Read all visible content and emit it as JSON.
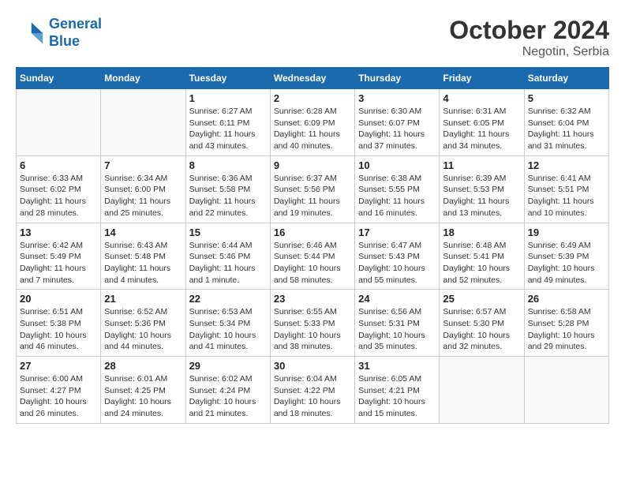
{
  "header": {
    "logo_line1": "General",
    "logo_line2": "Blue",
    "month": "October 2024",
    "location": "Negotin, Serbia"
  },
  "weekdays": [
    "Sunday",
    "Monday",
    "Tuesday",
    "Wednesday",
    "Thursday",
    "Friday",
    "Saturday"
  ],
  "weeks": [
    [
      {
        "day": "",
        "info": ""
      },
      {
        "day": "",
        "info": ""
      },
      {
        "day": "1",
        "info": "Sunrise: 6:27 AM\nSunset: 6:11 PM\nDaylight: 11 hours and 43 minutes."
      },
      {
        "day": "2",
        "info": "Sunrise: 6:28 AM\nSunset: 6:09 PM\nDaylight: 11 hours and 40 minutes."
      },
      {
        "day": "3",
        "info": "Sunrise: 6:30 AM\nSunset: 6:07 PM\nDaylight: 11 hours and 37 minutes."
      },
      {
        "day": "4",
        "info": "Sunrise: 6:31 AM\nSunset: 6:05 PM\nDaylight: 11 hours and 34 minutes."
      },
      {
        "day": "5",
        "info": "Sunrise: 6:32 AM\nSunset: 6:04 PM\nDaylight: 11 hours and 31 minutes."
      }
    ],
    [
      {
        "day": "6",
        "info": "Sunrise: 6:33 AM\nSunset: 6:02 PM\nDaylight: 11 hours and 28 minutes."
      },
      {
        "day": "7",
        "info": "Sunrise: 6:34 AM\nSunset: 6:00 PM\nDaylight: 11 hours and 25 minutes."
      },
      {
        "day": "8",
        "info": "Sunrise: 6:36 AM\nSunset: 5:58 PM\nDaylight: 11 hours and 22 minutes."
      },
      {
        "day": "9",
        "info": "Sunrise: 6:37 AM\nSunset: 5:56 PM\nDaylight: 11 hours and 19 minutes."
      },
      {
        "day": "10",
        "info": "Sunrise: 6:38 AM\nSunset: 5:55 PM\nDaylight: 11 hours and 16 minutes."
      },
      {
        "day": "11",
        "info": "Sunrise: 6:39 AM\nSunset: 5:53 PM\nDaylight: 11 hours and 13 minutes."
      },
      {
        "day": "12",
        "info": "Sunrise: 6:41 AM\nSunset: 5:51 PM\nDaylight: 11 hours and 10 minutes."
      }
    ],
    [
      {
        "day": "13",
        "info": "Sunrise: 6:42 AM\nSunset: 5:49 PM\nDaylight: 11 hours and 7 minutes."
      },
      {
        "day": "14",
        "info": "Sunrise: 6:43 AM\nSunset: 5:48 PM\nDaylight: 11 hours and 4 minutes."
      },
      {
        "day": "15",
        "info": "Sunrise: 6:44 AM\nSunset: 5:46 PM\nDaylight: 11 hours and 1 minute."
      },
      {
        "day": "16",
        "info": "Sunrise: 6:46 AM\nSunset: 5:44 PM\nDaylight: 10 hours and 58 minutes."
      },
      {
        "day": "17",
        "info": "Sunrise: 6:47 AM\nSunset: 5:43 PM\nDaylight: 10 hours and 55 minutes."
      },
      {
        "day": "18",
        "info": "Sunrise: 6:48 AM\nSunset: 5:41 PM\nDaylight: 10 hours and 52 minutes."
      },
      {
        "day": "19",
        "info": "Sunrise: 6:49 AM\nSunset: 5:39 PM\nDaylight: 10 hours and 49 minutes."
      }
    ],
    [
      {
        "day": "20",
        "info": "Sunrise: 6:51 AM\nSunset: 5:38 PM\nDaylight: 10 hours and 46 minutes."
      },
      {
        "day": "21",
        "info": "Sunrise: 6:52 AM\nSunset: 5:36 PM\nDaylight: 10 hours and 44 minutes."
      },
      {
        "day": "22",
        "info": "Sunrise: 6:53 AM\nSunset: 5:34 PM\nDaylight: 10 hours and 41 minutes."
      },
      {
        "day": "23",
        "info": "Sunrise: 6:55 AM\nSunset: 5:33 PM\nDaylight: 10 hours and 38 minutes."
      },
      {
        "day": "24",
        "info": "Sunrise: 6:56 AM\nSunset: 5:31 PM\nDaylight: 10 hours and 35 minutes."
      },
      {
        "day": "25",
        "info": "Sunrise: 6:57 AM\nSunset: 5:30 PM\nDaylight: 10 hours and 32 minutes."
      },
      {
        "day": "26",
        "info": "Sunrise: 6:58 AM\nSunset: 5:28 PM\nDaylight: 10 hours and 29 minutes."
      }
    ],
    [
      {
        "day": "27",
        "info": "Sunrise: 6:00 AM\nSunset: 4:27 PM\nDaylight: 10 hours and 26 minutes."
      },
      {
        "day": "28",
        "info": "Sunrise: 6:01 AM\nSunset: 4:25 PM\nDaylight: 10 hours and 24 minutes."
      },
      {
        "day": "29",
        "info": "Sunrise: 6:02 AM\nSunset: 4:24 PM\nDaylight: 10 hours and 21 minutes."
      },
      {
        "day": "30",
        "info": "Sunrise: 6:04 AM\nSunset: 4:22 PM\nDaylight: 10 hours and 18 minutes."
      },
      {
        "day": "31",
        "info": "Sunrise: 6:05 AM\nSunset: 4:21 PM\nDaylight: 10 hours and 15 minutes."
      },
      {
        "day": "",
        "info": ""
      },
      {
        "day": "",
        "info": ""
      }
    ]
  ]
}
